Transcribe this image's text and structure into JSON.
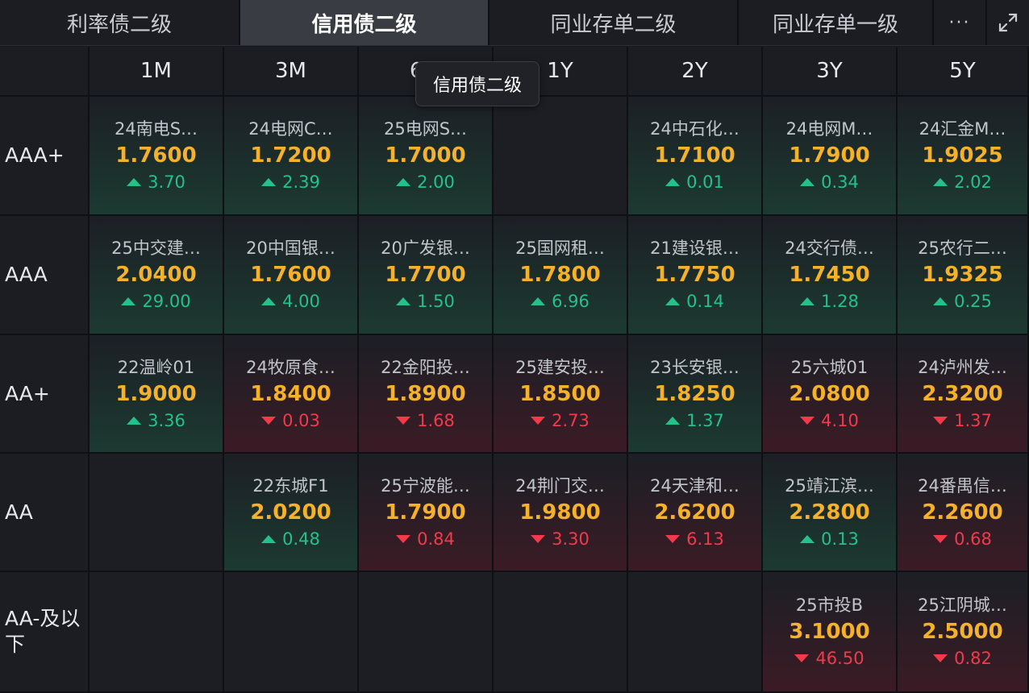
{
  "tabs": [
    {
      "label": "利率债二级",
      "active": false
    },
    {
      "label": "信用债二级",
      "active": true
    },
    {
      "label": "同业存单二级",
      "active": false
    },
    {
      "label": "同业存单一级",
      "active": false
    }
  ],
  "more_label": "···",
  "tooltip": "信用债二级",
  "columns": [
    "1M",
    "3M",
    "6M",
    "1Y",
    "2Y",
    "3Y",
    "5Y"
  ],
  "rows": [
    "AAA+",
    "AAA",
    "AA+",
    "AA",
    "AA-及以下"
  ],
  "colors": {
    "up": "#26c08a",
    "down": "#f23a4b",
    "value": "#f5b12a"
  },
  "cells": [
    [
      {
        "name": "24南电S…",
        "value": "1.7600",
        "change": "3.70",
        "dir": "up"
      },
      {
        "name": "24电网C…",
        "value": "1.7200",
        "change": "2.39",
        "dir": "up"
      },
      {
        "name": "25电网S…",
        "value": "1.7000",
        "change": "2.00",
        "dir": "up"
      },
      null,
      {
        "name": "24中石化…",
        "value": "1.7100",
        "change": "0.01",
        "dir": "up"
      },
      {
        "name": "24电网M…",
        "value": "1.7900",
        "change": "0.34",
        "dir": "up"
      },
      {
        "name": "24汇金M…",
        "value": "1.9025",
        "change": "2.02",
        "dir": "up"
      }
    ],
    [
      {
        "name": "25中交建…",
        "value": "2.0400",
        "change": "29.00",
        "dir": "up"
      },
      {
        "name": "20中国银…",
        "value": "1.7600",
        "change": "4.00",
        "dir": "up"
      },
      {
        "name": "20广发银…",
        "value": "1.7700",
        "change": "1.50",
        "dir": "up"
      },
      {
        "name": "25国网租…",
        "value": "1.7800",
        "change": "6.96",
        "dir": "up"
      },
      {
        "name": "21建设银…",
        "value": "1.7750",
        "change": "0.14",
        "dir": "up"
      },
      {
        "name": "24交行债…",
        "value": "1.7450",
        "change": "1.28",
        "dir": "up"
      },
      {
        "name": "25农行二…",
        "value": "1.9325",
        "change": "0.25",
        "dir": "up"
      }
    ],
    [
      {
        "name": "22温岭01",
        "value": "1.9000",
        "change": "3.36",
        "dir": "up"
      },
      {
        "name": "24牧原食…",
        "value": "1.8400",
        "change": "0.03",
        "dir": "down"
      },
      {
        "name": "22金阳投…",
        "value": "1.8900",
        "change": "1.68",
        "dir": "down"
      },
      {
        "name": "25建安投…",
        "value": "1.8500",
        "change": "2.73",
        "dir": "down"
      },
      {
        "name": "23长安银…",
        "value": "1.8250",
        "change": "1.37",
        "dir": "up"
      },
      {
        "name": "25六城01",
        "value": "2.0800",
        "change": "4.10",
        "dir": "down"
      },
      {
        "name": "24泸州发…",
        "value": "2.3200",
        "change": "1.37",
        "dir": "down"
      }
    ],
    [
      null,
      {
        "name": "22东城F1",
        "value": "2.0200",
        "change": "0.48",
        "dir": "up"
      },
      {
        "name": "25宁波能…",
        "value": "1.7900",
        "change": "0.84",
        "dir": "down"
      },
      {
        "name": "24荆门交…",
        "value": "1.9800",
        "change": "3.30",
        "dir": "down"
      },
      {
        "name": "24天津和…",
        "value": "2.6200",
        "change": "6.13",
        "dir": "down"
      },
      {
        "name": "25靖江滨…",
        "value": "2.2800",
        "change": "0.13",
        "dir": "up"
      },
      {
        "name": "24番禺信…",
        "value": "2.2600",
        "change": "0.68",
        "dir": "down"
      }
    ],
    [
      null,
      null,
      null,
      null,
      null,
      {
        "name": "25市投B",
        "value": "3.1000",
        "change": "46.50",
        "dir": "down"
      },
      {
        "name": "25江阴城…",
        "value": "2.5000",
        "change": "0.82",
        "dir": "down"
      }
    ]
  ]
}
